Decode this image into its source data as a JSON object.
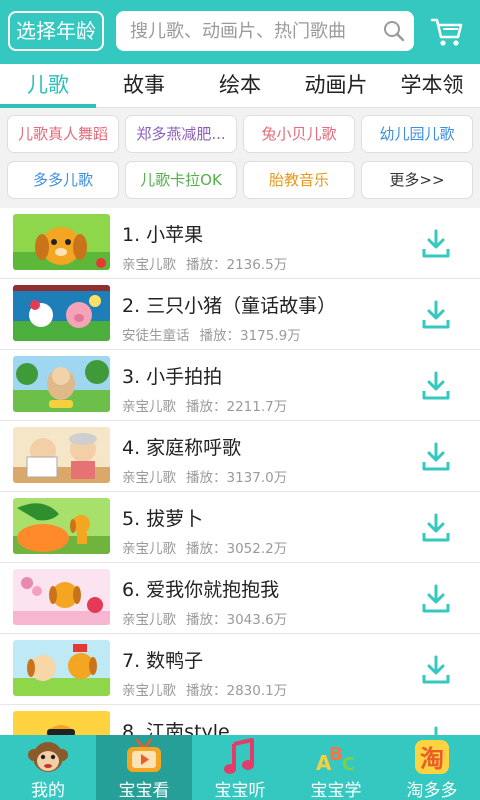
{
  "header": {
    "age_button": "选择年龄",
    "search_placeholder": "搜儿歌、动画片、热门歌曲"
  },
  "tabs": [
    {
      "label": "儿歌",
      "active": true
    },
    {
      "label": "故事",
      "active": false
    },
    {
      "label": "绘本",
      "active": false
    },
    {
      "label": "动画片",
      "active": false
    },
    {
      "label": "学本领",
      "active": false
    }
  ],
  "chips": [
    {
      "label": "儿歌真人舞蹈",
      "color": "#e36b7a"
    },
    {
      "label": "郑多燕减肥...",
      "color": "#8e5fb8"
    },
    {
      "label": "兔小贝儿歌",
      "color": "#e36b7a"
    },
    {
      "label": "幼儿园儿歌",
      "color": "#3d8ede"
    },
    {
      "label": "多多儿歌",
      "color": "#3d8ede"
    },
    {
      "label": "儿歌卡拉OK",
      "color": "#52b04a"
    },
    {
      "label": "胎教音乐",
      "color": "#e59a1a"
    },
    {
      "label": "更多>>",
      "color": "#333333"
    }
  ],
  "songs": [
    {
      "title": "1. 小苹果",
      "source": "亲宝儿歌",
      "plays": "播放：2136.5万"
    },
    {
      "title": "2. 三只小猪（童话故事）",
      "source": "安徒生童话",
      "plays": "播放：3175.9万"
    },
    {
      "title": "3. 小手拍拍",
      "source": "亲宝儿歌",
      "plays": "播放：2211.7万"
    },
    {
      "title": "4. 家庭称呼歌",
      "source": "亲宝儿歌",
      "plays": "播放：3137.0万"
    },
    {
      "title": "5. 拔萝卜",
      "source": "亲宝儿歌",
      "plays": "播放：3052.2万"
    },
    {
      "title": "6. 爱我你就抱抱我",
      "source": "亲宝儿歌",
      "plays": "播放：3043.6万"
    },
    {
      "title": "7. 数鸭子",
      "source": "亲宝儿歌",
      "plays": "播放：2830.1万"
    },
    {
      "title": "8. 江南style",
      "source": "",
      "plays": ""
    }
  ],
  "bottom_nav": [
    {
      "label": "我的",
      "icon": "monkey-icon",
      "active": false
    },
    {
      "label": "宝宝看",
      "icon": "tv-icon",
      "active": true
    },
    {
      "label": "宝宝听",
      "icon": "music-note-icon",
      "active": false
    },
    {
      "label": "宝宝学",
      "icon": "abc-icon",
      "active": false
    },
    {
      "label": "淘多多",
      "icon": "tao-icon",
      "active": false
    }
  ],
  "colors": {
    "brand": "#35c8c0",
    "brand_dark": "#259f98",
    "accent": "#2fc0b8"
  }
}
